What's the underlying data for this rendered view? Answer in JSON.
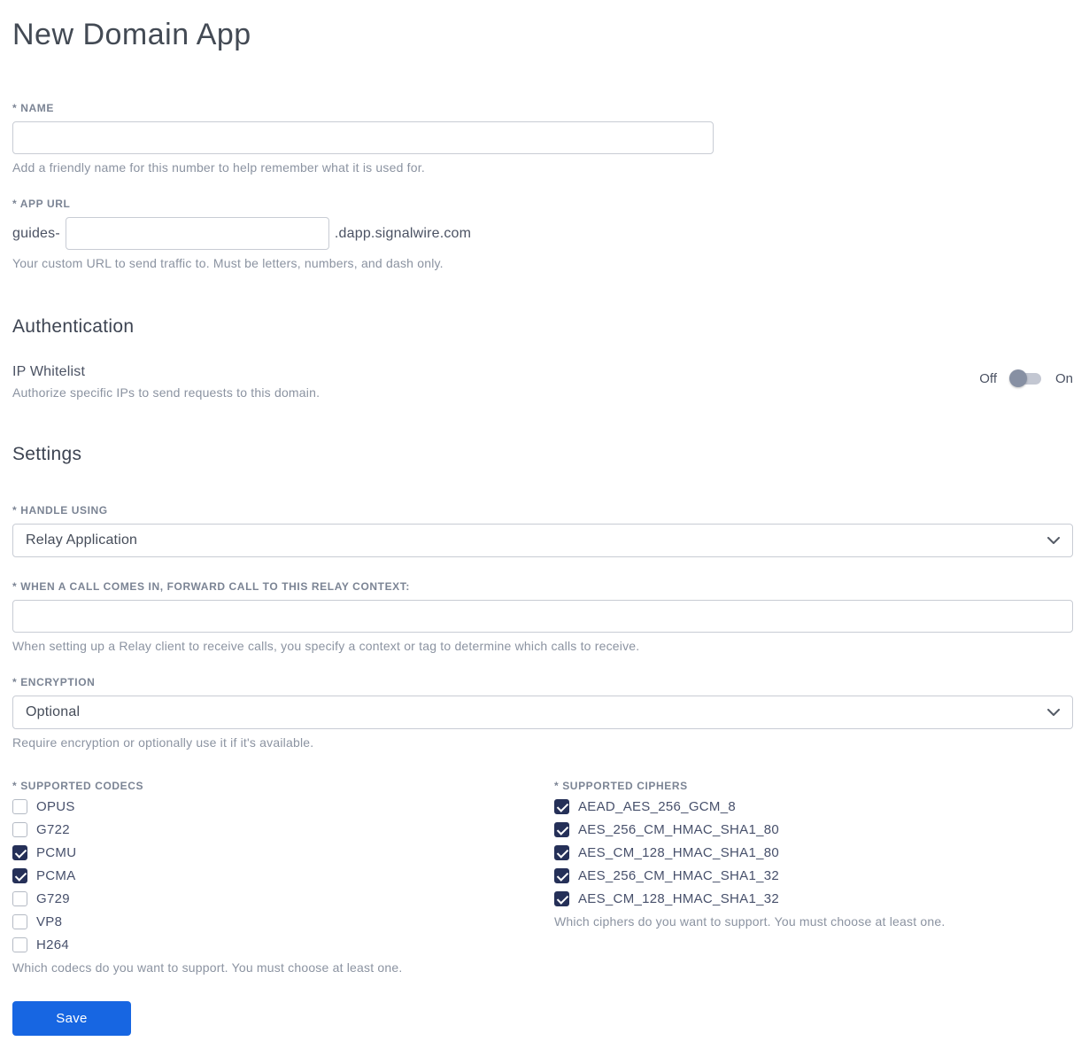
{
  "page": {
    "title": "New Domain App"
  },
  "name_field": {
    "label": "* Name",
    "value": "",
    "help": "Add a friendly name for this number to help remember what it is used for."
  },
  "app_url_field": {
    "label": "* App URL",
    "prefix": "guides-",
    "value": "",
    "suffix": ".dapp.signalwire.com",
    "help": "Your custom URL to send traffic to. Must be letters, numbers, and dash only."
  },
  "authentication": {
    "heading": "Authentication",
    "ip_whitelist": {
      "label": "IP Whitelist",
      "description": "Authorize specific IPs to send requests to this domain.",
      "off_label": "Off",
      "on_label": "On",
      "state": "off"
    }
  },
  "settings": {
    "heading": "Settings",
    "handle_using": {
      "label": "* Handle using",
      "value": "Relay Application"
    },
    "relay_context": {
      "label": "* When a call comes in, forward call to this relay context:",
      "value": "",
      "help": "When setting up a Relay client to receive calls, you specify a context or tag to determine which calls to receive."
    },
    "encryption": {
      "label": "* Encryption",
      "value": "Optional",
      "help": "Require encryption or optionally use it if it's available."
    },
    "codecs": {
      "label": "* Supported codecs",
      "items": [
        {
          "label": "OPUS",
          "checked": false
        },
        {
          "label": "G722",
          "checked": false
        },
        {
          "label": "PCMU",
          "checked": true
        },
        {
          "label": "PCMA",
          "checked": true
        },
        {
          "label": "G729",
          "checked": false
        },
        {
          "label": "VP8",
          "checked": false
        },
        {
          "label": "H264",
          "checked": false
        }
      ],
      "help": "Which codecs do you want to support. You must choose at least one."
    },
    "ciphers": {
      "label": "* Supported ciphers",
      "items": [
        {
          "label": "AEAD_AES_256_GCM_8",
          "checked": true
        },
        {
          "label": "AES_256_CM_HMAC_SHA1_80",
          "checked": true
        },
        {
          "label": "AES_CM_128_HMAC_SHA1_80",
          "checked": true
        },
        {
          "label": "AES_256_CM_HMAC_SHA1_32",
          "checked": true
        },
        {
          "label": "AES_CM_128_HMAC_SHA1_32",
          "checked": true
        }
      ],
      "help": "Which ciphers do you want to support. You must choose at least one."
    }
  },
  "actions": {
    "save_label": "Save"
  },
  "colors": {
    "accent_blue": "#1766e2",
    "checkbox_checked": "#253058",
    "heading_text": "#3d4452",
    "muted_text": "#8b93a1"
  }
}
